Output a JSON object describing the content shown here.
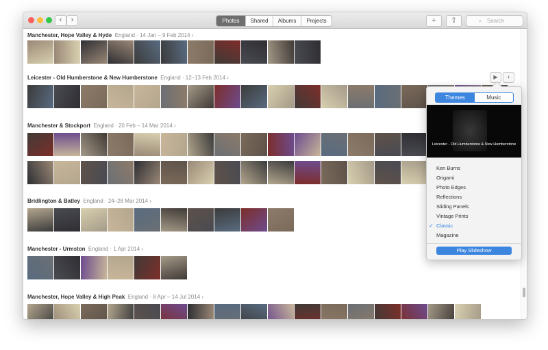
{
  "toolbar": {
    "back": "‹",
    "forward": "›",
    "tabs": [
      "Photos",
      "Shared",
      "Albums",
      "Projects"
    ],
    "selected_tab": "Photos",
    "add": "+",
    "share": "⇪",
    "search_placeholder": "Search"
  },
  "moments": [
    {
      "title": "Manchester, Hope Valley & Hyde",
      "country": "England",
      "dates": "14 Jan – 9 Feb 2014"
    },
    {
      "title": "Leicester - Old Humberstone & New Humberstone",
      "country": "England",
      "dates": "12–13 Feb 2014"
    },
    {
      "title": "Manchester & Stockport",
      "country": "England",
      "dates": "20 Feb – 14 Mar 2014"
    },
    {
      "title": "Bridlington & Batley",
      "country": "England",
      "dates": "24–28 Mar 2014"
    },
    {
      "title": "Manchester - Urmston",
      "country": "England",
      "dates": "1 Apr 2014"
    },
    {
      "title": "Manchester, Hope Valley & High Peak",
      "country": "England",
      "dates": "8 Apr – 14 Jul 2014"
    }
  ],
  "row_controls": {
    "play": "▶",
    "add": "+"
  },
  "popover": {
    "tabs": [
      "Themes",
      "Music"
    ],
    "selected_tab": "Themes",
    "preview_caption": "Leicester - Old Humberstone & New Humberstone",
    "themes": [
      "Ken Burns",
      "Origami",
      "Photo Edges",
      "Reflections",
      "Sliding Panels",
      "Vintage Prints",
      "Classic",
      "Magazine"
    ],
    "selected_theme": "Classic",
    "checkmark": "✓",
    "play_label": "Play Slideshow"
  },
  "colors": {
    "accent": "#3d86e0",
    "close": "#fc605c",
    "minimize": "#fdbc40",
    "zoom": "#34c84a"
  }
}
